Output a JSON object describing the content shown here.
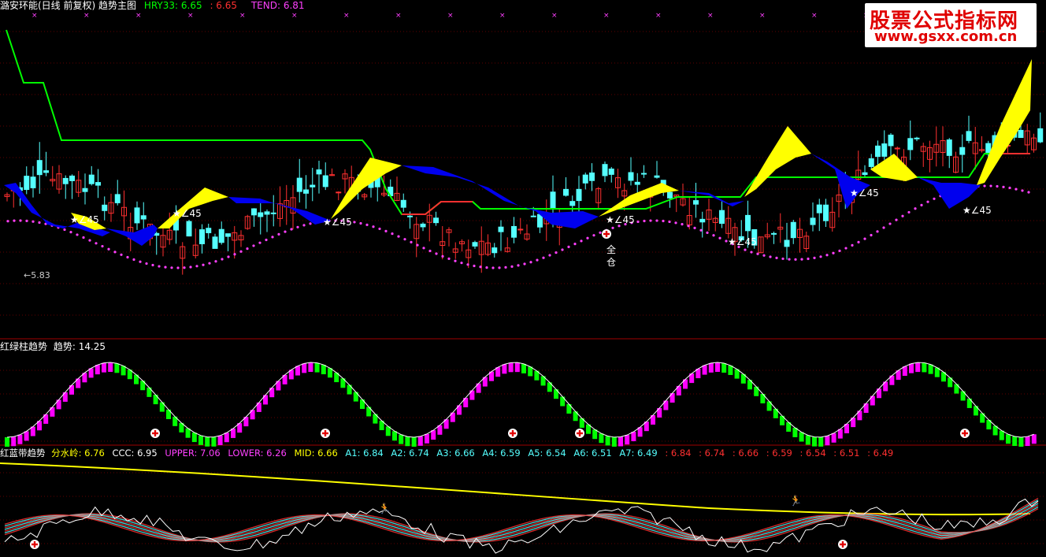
{
  "main_panel": {
    "title": "潞安环能(日线 前复权) 趋势主图",
    "indicators": [
      {
        "label": "HRY33: 6.65",
        "color": "#00ff00"
      },
      {
        "label": ": 6.65",
        "color": "#ff3030"
      },
      {
        "label": "TEND: 6.81",
        "color": "#ff40ff"
      }
    ],
    "annotations": {
      "low_price": "5.83",
      "angle_label": "∠45",
      "full_position": [
        "全",
        "仓"
      ]
    }
  },
  "sub_panel_1": {
    "title": "红绿柱趋势",
    "indicators": [
      {
        "label": "趋势: 14.25",
        "color": "#ffffff"
      }
    ]
  },
  "sub_panel_2": {
    "title": "红蓝带趋势",
    "indicators": [
      {
        "label": "分水岭: 6.76",
        "color": "#ffff00"
      },
      {
        "label": "CCC: 6.95",
        "color": "#ffffff"
      },
      {
        "label": "UPPER: 7.06",
        "color": "#ff40ff"
      },
      {
        "label": "LOWER: 6.26",
        "color": "#ff40ff"
      },
      {
        "label": "MID: 6.66",
        "color": "#ffff00"
      },
      {
        "label": "A1: 6.84",
        "color": "#55ffff"
      },
      {
        "label": "A2: 6.74",
        "color": "#55ffff"
      },
      {
        "label": "A3: 6.66",
        "color": "#55ffff"
      },
      {
        "label": "A4: 6.59",
        "color": "#55ffff"
      },
      {
        "label": "A5: 6.54",
        "color": "#55ffff"
      },
      {
        "label": "A6: 6.51",
        "color": "#55ffff"
      },
      {
        "label": "A7: 6.49",
        "color": "#55ffff"
      },
      {
        "label": ": 6.84",
        "color": "#ff3030"
      },
      {
        "label": ": 6.74",
        "color": "#ff3030"
      },
      {
        "label": ": 6.66",
        "color": "#ff3030"
      },
      {
        "label": ": 6.59",
        "color": "#ff3030"
      },
      {
        "label": ": 6.54",
        "color": "#ff3030"
      },
      {
        "label": ": 6.51",
        "color": "#ff3030"
      },
      {
        "label": ": 6.49",
        "color": "#ff3030"
      }
    ]
  },
  "watermark": {
    "line1": "股票公式指标网",
    "line2": "www.gsxx.com.cn"
  },
  "colors": {
    "background": "#000000",
    "up_candle": "#ff3030",
    "down_candle": "#55ffff",
    "grid": "#800000",
    "yellow_band": "#ffff00",
    "blue_band": "#0000ee",
    "green_bar": "#00ff00",
    "magenta_bar": "#ff00ff"
  }
}
